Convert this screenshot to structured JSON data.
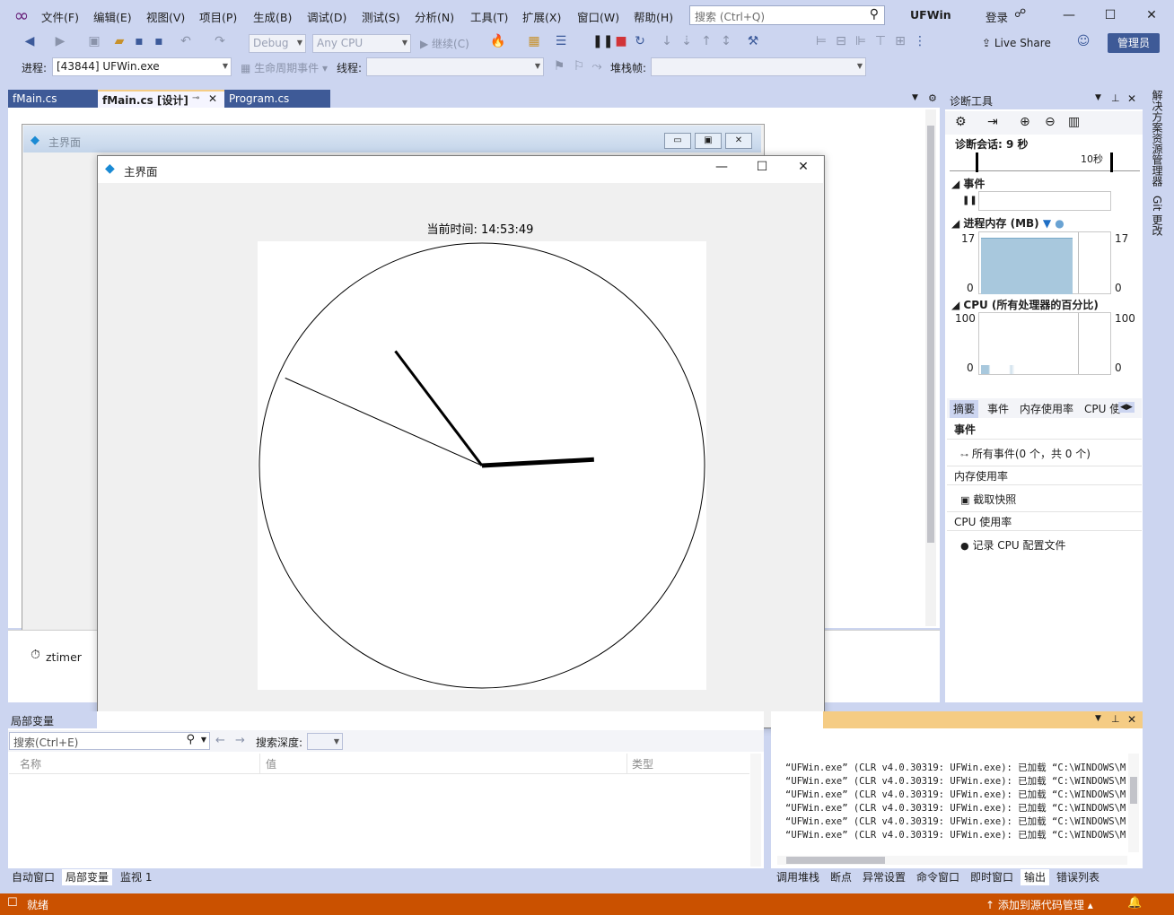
{
  "menu": [
    "文件(F)",
    "编辑(E)",
    "视图(V)",
    "项目(P)",
    "生成(B)",
    "调试(D)",
    "测试(S)",
    "分析(N)",
    "工具(T)",
    "扩展(X)",
    "窗口(W)",
    "帮助(H)"
  ],
  "search": {
    "placeholder": "搜索 (Ctrl+Q)"
  },
  "solution_name": "UFWin",
  "login_label": "登录",
  "toolbar": {
    "config": "Debug",
    "platform": "Any CPU",
    "continue_label": "继续(C)",
    "live_share": "Live Share",
    "admin_badge": "管理员",
    "process_label": "进程:",
    "process_value": "[43844] UFWin.exe",
    "lifecycle_label": "生命周期事件",
    "thread_label": "线程:",
    "stackframe_label": "堆栈帧:"
  },
  "doc_tabs": [
    "fMain.cs",
    "fMain.cs [设计]",
    "Program.cs"
  ],
  "designer": {
    "form_title": "主界面",
    "component": "ztimer"
  },
  "running_window": {
    "title": "主界面",
    "time_label": "当前时间: 14:53:49",
    "clock": {
      "hours": 14,
      "minutes": 53,
      "seconds": 49
    }
  },
  "diagnostics": {
    "title": "诊断工具",
    "session": "诊断会话: 9 秒",
    "timeline_label": "10秒",
    "events_label": "事件",
    "memory_label": "进程内存 (MB)",
    "memory_max": "17",
    "memory_min": "0",
    "cpu_label": "CPU (所有处理器的百分比)",
    "cpu_max": "100",
    "cpu_min": "0",
    "tabs": [
      "摘要",
      "事件",
      "内存使用率",
      "CPU 使"
    ],
    "sections": {
      "events_head": "事件",
      "all_events": "所有事件(0 个，共 0 个)",
      "memory_head": "内存使用率",
      "snapshot": "截取快照",
      "cpu_head": "CPU 使用率",
      "record_cpu": "记录 CPU 配置文件"
    }
  },
  "right_rail": [
    "解决方案资源管理器",
    "Git 更改"
  ],
  "locals": {
    "title": "局部变量",
    "search_placeholder": "搜索(Ctrl+E)",
    "depth_label": "搜索深度:",
    "columns": [
      "名称",
      "值",
      "类型"
    ]
  },
  "output": {
    "lines": [
      "“UFWin.exe” (CLR v4.0.30319: UFWin.exe): 已加载 “C:\\WINDOWS\\Mic",
      "“UFWin.exe” (CLR v4.0.30319: UFWin.exe): 已加载 “C:\\WINDOWS\\Mic",
      "“UFWin.exe” (CLR v4.0.30319: UFWin.exe): 已加载 “C:\\WINDOWS\\Mic",
      "“UFWin.exe” (CLR v4.0.30319: UFWin.exe): 已加载 “C:\\WINDOWS\\Mic",
      "“UFWin.exe” (CLR v4.0.30319: UFWin.exe): 已加载 “C:\\WINDOWS\\Mic",
      "“UFWin.exe” (CLR v4.0.30319: UFWin.exe): 已加载 “C:\\WINDOWS\\Mic"
    ]
  },
  "bottom_tabs_left": [
    "自动窗口",
    "局部变量",
    "监视 1"
  ],
  "bottom_tabs_right": [
    "调用堆栈",
    "断点",
    "异常设置",
    "命令窗口",
    "即时窗口",
    "输出",
    "错误列表"
  ],
  "status": {
    "text": "就绪",
    "source_control": "添加到源代码管理"
  },
  "colors": {
    "accent": "#3E5A97",
    "status_bar": "#CA5100",
    "frame": "#CCD5F0",
    "output_header": "#F5CC84"
  }
}
